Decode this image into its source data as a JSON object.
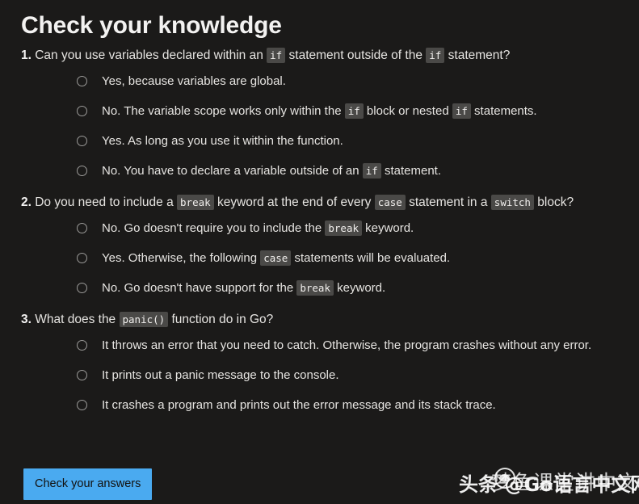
{
  "page": {
    "title": "Check your knowledge",
    "background_color": "#1b1a19",
    "text_color": "#e6e4e1"
  },
  "questions": [
    {
      "number": "1.",
      "text_parts": [
        {
          "type": "text",
          "value": "Can you use variables declared within an "
        },
        {
          "type": "code",
          "value": "if"
        },
        {
          "type": "text",
          "value": " statement outside of the "
        },
        {
          "type": "code",
          "value": "if"
        },
        {
          "type": "text",
          "value": " statement?"
        }
      ],
      "plain_text": "Can you use variables declared within an if statement outside of the if statement?",
      "options": [
        {
          "selected": false,
          "plain_text": "Yes, because variables are global.",
          "parts": [
            {
              "type": "text",
              "value": "Yes, because variables are global."
            }
          ]
        },
        {
          "selected": false,
          "plain_text": "No. The variable scope works only within the if block or nested if statements.",
          "parts": [
            {
              "type": "text",
              "value": "No. The variable scope works only within the "
            },
            {
              "type": "code",
              "value": "if"
            },
            {
              "type": "text",
              "value": " block or nested "
            },
            {
              "type": "code",
              "value": "if"
            },
            {
              "type": "text",
              "value": " statements."
            }
          ]
        },
        {
          "selected": false,
          "plain_text": "Yes. As long as you use it within the function.",
          "parts": [
            {
              "type": "text",
              "value": "Yes. As long as you use it within the function."
            }
          ]
        },
        {
          "selected": false,
          "plain_text": "No. You have to declare a variable outside of an if statement.",
          "parts": [
            {
              "type": "text",
              "value": "No. You have to declare a variable outside of an "
            },
            {
              "type": "code",
              "value": "if"
            },
            {
              "type": "text",
              "value": " statement."
            }
          ]
        }
      ]
    },
    {
      "number": "2.",
      "text_parts": [
        {
          "type": "text",
          "value": "Do you need to include a "
        },
        {
          "type": "code",
          "value": "break"
        },
        {
          "type": "text",
          "value": " keyword at the end of every "
        },
        {
          "type": "code",
          "value": "case"
        },
        {
          "type": "text",
          "value": " statement in a "
        },
        {
          "type": "code",
          "value": "switch"
        },
        {
          "type": "text",
          "value": " block?"
        }
      ],
      "plain_text": "Do you need to include a break keyword at the end of every case statement in a switch block?",
      "options": [
        {
          "selected": false,
          "plain_text": "No. Go doesn't require you to include the break keyword.",
          "parts": [
            {
              "type": "text",
              "value": "No. Go doesn't require you to include the "
            },
            {
              "type": "code",
              "value": "break"
            },
            {
              "type": "text",
              "value": " keyword."
            }
          ]
        },
        {
          "selected": false,
          "plain_text": "Yes. Otherwise, the following case statements will be evaluated.",
          "parts": [
            {
              "type": "text",
              "value": "Yes. Otherwise, the following "
            },
            {
              "type": "code",
              "value": "case"
            },
            {
              "type": "text",
              "value": " statements will be evaluated."
            }
          ]
        },
        {
          "selected": false,
          "plain_text": "No. Go doesn't have support for the break keyword.",
          "parts": [
            {
              "type": "text",
              "value": "No. Go doesn't have support for the "
            },
            {
              "type": "code",
              "value": "break"
            },
            {
              "type": "text",
              "value": " keyword."
            }
          ]
        }
      ]
    },
    {
      "number": "3.",
      "text_parts": [
        {
          "type": "text",
          "value": "What does the "
        },
        {
          "type": "code",
          "value": "panic()"
        },
        {
          "type": "text",
          "value": " function do in Go?"
        }
      ],
      "plain_text": "What does the panic() function do in Go?",
      "options": [
        {
          "selected": false,
          "plain_text": "It throws an error that you need to catch. Otherwise, the program crashes without any error.",
          "parts": [
            {
              "type": "text",
              "value": "It throws an error that you need to catch. Otherwise, the program crashes without any error."
            }
          ]
        },
        {
          "selected": false,
          "plain_text": "It prints out a panic message to the console.",
          "parts": [
            {
              "type": "text",
              "value": "It prints out a panic message to the console."
            }
          ]
        },
        {
          "selected": false,
          "plain_text": "It crashes a program and prints out the error message and its stack trace.",
          "parts": [
            {
              "type": "text",
              "value": "It crashes a program and prints out the error message and its stack trace."
            }
          ]
        }
      ]
    }
  ],
  "actions": {
    "check_answers_label": "Check your answers",
    "check_answers_color": "#4aaaf0"
  },
  "watermarks": {
    "primary": "头条 @Go语言中文网",
    "secondary": "梦鱼课堂讲中文网"
  }
}
